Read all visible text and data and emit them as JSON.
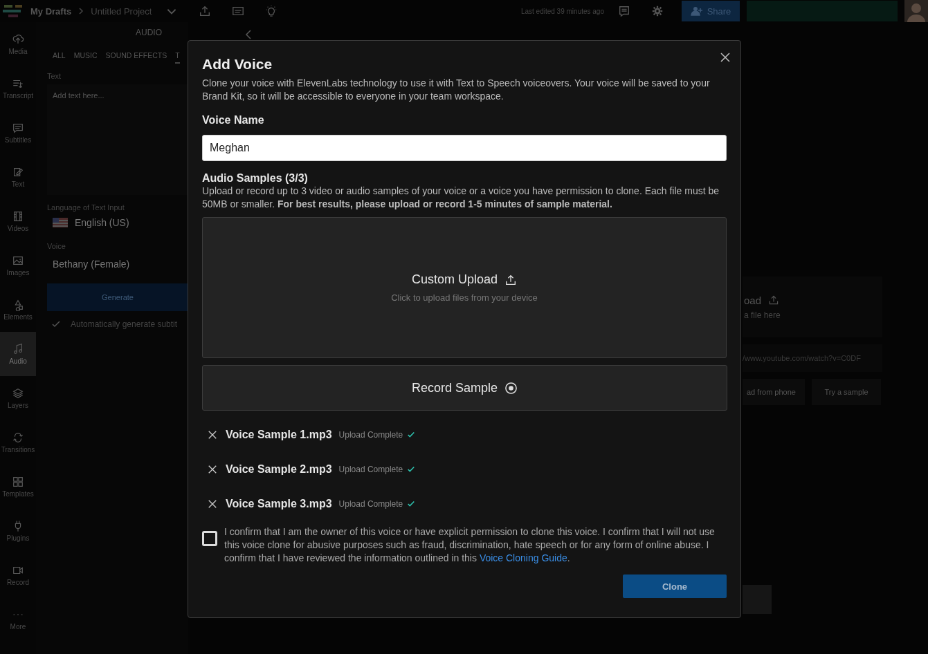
{
  "top_bar": {
    "breadcrumb": "My Drafts",
    "project": "Untitled Project",
    "last_edited": "Last edited 39 minutes ago",
    "share": "Share"
  },
  "sidebar": {
    "items": [
      {
        "label": "Media",
        "kind": "media",
        "selected": false
      },
      {
        "label": "Transcript",
        "kind": "transcript",
        "selected": false
      },
      {
        "label": "Subtitles",
        "kind": "subtitles",
        "selected": false
      },
      {
        "label": "Text",
        "kind": "text",
        "selected": false
      },
      {
        "label": "Videos",
        "kind": "videos",
        "selected": false
      },
      {
        "label": "Images",
        "kind": "images",
        "selected": false
      },
      {
        "label": "Elements",
        "kind": "elements",
        "selected": false
      },
      {
        "label": "Audio",
        "kind": "audio",
        "selected": true
      },
      {
        "label": "Layers",
        "kind": "layers",
        "selected": false
      },
      {
        "label": "Transitions",
        "kind": "transitions",
        "selected": false
      },
      {
        "label": "Templates",
        "kind": "templates",
        "selected": false
      },
      {
        "label": "Plugins",
        "kind": "plugins",
        "selected": false
      },
      {
        "label": "Record",
        "kind": "record",
        "selected": false
      },
      {
        "label": "More",
        "kind": "more",
        "selected": false
      }
    ]
  },
  "audio_panel": {
    "title": "AUDIO",
    "tabs": [
      {
        "label": "ALL",
        "selected": false
      },
      {
        "label": "MUSIC",
        "selected": false
      },
      {
        "label": "SOUND EFFECTS",
        "selected": false
      },
      {
        "label": "T",
        "selected": true
      }
    ],
    "text_field": {
      "label": "Text",
      "placeholder": "Add text here..."
    },
    "language": {
      "label": "Language of Text Input",
      "value": "English (US)"
    },
    "voice": {
      "label": "Voice",
      "value": "Bethany (Female)"
    },
    "generate": "Generate",
    "auto_subtitles": {
      "label": "Automatically generate subtit",
      "checked": true
    }
  },
  "canvas": {
    "upload_title": "oad",
    "upload_hint": "a file here",
    "url_value": "/www.youtube.com/watch?v=C0DF",
    "buttons": [
      "ad from phone",
      "Try a sample"
    ]
  },
  "dialog": {
    "title": "Add Voice",
    "description": "Clone your voice with ElevenLabs technology to use it with Text to Speech voiceovers. Your voice will be saved to your Brand Kit, so it will be accessible to everyone in your team workspace.",
    "voice_name": {
      "label": "Voice Name",
      "value": "Meghan"
    },
    "samples_label": "Audio Samples (3/3)",
    "samples_description": "Upload or record up to 3 video or audio samples of your voice or a voice you have permission to clone. Each file must be 50MB or smaller. **For best results, please upload or record 1-5 minutes of sample material.**",
    "upload": {
      "title": "Custom Upload",
      "hint": "Click to upload files from your device"
    },
    "record": "Record Sample",
    "samples": [
      {
        "name": "Voice Sample 1.mp3",
        "status": "Upload Complete",
        "complete": true
      },
      {
        "name": "Voice Sample 2.mp3",
        "status": "Upload Complete",
        "complete": true
      },
      {
        "name": "Voice Sample 3.mp3",
        "status": "Upload Complete",
        "complete": true
      }
    ],
    "consent": {
      "text": "I confirm that I am the owner of this voice or have explicit permission to clone this voice. I confirm that I will not use this voice clone for abusive purposes such as fraud, discrimination, hate speech or for any form of online abuse. I confirm that I have reviewed the information outlined in this ",
      "link": "Voice Cloning Guide",
      "suffix": ".",
      "checked": false
    },
    "clone": "Clone"
  }
}
